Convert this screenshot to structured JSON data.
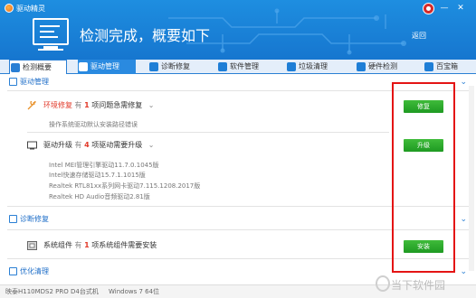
{
  "app": {
    "title": "驱动精灵"
  },
  "header": {
    "headline": "检测完成，概要如下",
    "back_label": "返回"
  },
  "window_controls": {
    "minimize": "—",
    "close": "✕"
  },
  "tabs": [
    {
      "label": "检测概要",
      "icon": "monitor-icon"
    },
    {
      "label": "驱动管理",
      "icon": "gear-icon"
    },
    {
      "label": "诊断修复",
      "icon": "stethoscope-icon"
    },
    {
      "label": "软件管理",
      "icon": "software-icon"
    },
    {
      "label": "垃圾清理",
      "icon": "broom-icon"
    },
    {
      "label": "硬件检测",
      "icon": "hardware-icon"
    },
    {
      "label": "百宝箱",
      "icon": "toolbox-icon"
    }
  ],
  "sections": {
    "driver_mgmt": {
      "title": "驱动管理",
      "env_fix": {
        "label": "环境修复",
        "prefix": "有",
        "count": "1",
        "suffix": "项问题急需修复",
        "desc": "操作系统驱动默认安装路径错误",
        "button": "修复"
      },
      "driver_upgrade": {
        "label": "驱动升级",
        "prefix": "有",
        "count": "4",
        "suffix": "项驱动需要升级",
        "button": "升级",
        "items": [
          "Intel MEI管理引擎驱动11.7.0.1045版",
          "Intel快速存储驱动15.7.1.1015版",
          "Realtek RTL81xx系列网卡驱动7.115.1208.2017版",
          "Realtek HD Audio音频驱动2.81版"
        ]
      }
    },
    "diagnose": {
      "title": "诊断修复",
      "sys_component": {
        "label": "系统组件",
        "prefix": "有",
        "count": "1",
        "suffix": "项系统组件需要安装",
        "button": "安装"
      }
    },
    "optimize": {
      "title": "优化清理"
    }
  },
  "status": {
    "board": "映泰H110MDS2 PRO D4台式机",
    "os": "Windows 7 64位"
  },
  "watermark": "当下软件园",
  "colors": {
    "accent": "#1e7ed6",
    "button_green": "#2aa52a",
    "highlight_red": "#e41414",
    "warning_red": "#e23a2a"
  }
}
